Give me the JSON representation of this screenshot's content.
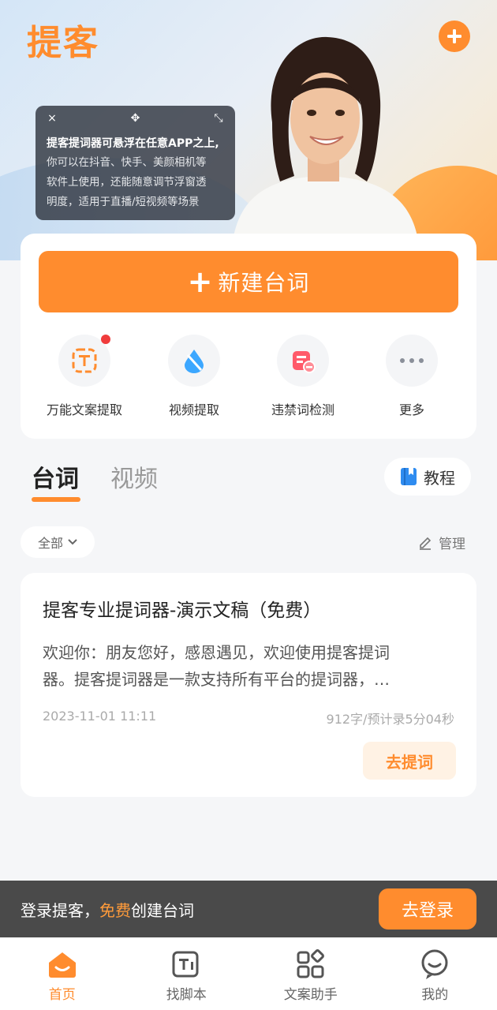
{
  "header": {
    "logo": "提客"
  },
  "popup": {
    "line1": "提客提词器可悬浮在任意APP之上,",
    "line2": "你可以在抖音、快手、美颜相机等",
    "line3": "软件上使用，还能随意调节浮窗透",
    "line4": "明度，适用于直播/短视频等场景",
    "close": "×",
    "move": "✥",
    "shrink": "⤡"
  },
  "main": {
    "new_button": "新建台词",
    "tools": [
      {
        "label": "万能文案提取",
        "badge": true
      },
      {
        "label": "视频提取"
      },
      {
        "label": "违禁词检测"
      },
      {
        "label": "更多"
      }
    ]
  },
  "tabs": [
    {
      "label": "台词",
      "active": true
    },
    {
      "label": "视频",
      "active": false
    }
  ],
  "tutorial_label": "教程",
  "filter_label": "全部",
  "manage_label": "管理",
  "script": {
    "title": "提客专业提词器-演示文稿（免费）",
    "body_line1": "欢迎你：朋友您好，感恩遇见，欢迎使用提客提词",
    "body_line2": "器。提客提词器是一款支持所有平台的提词器，…",
    "date": "2023-11-01 11:11",
    "stats": "912字/预计录5分04秒",
    "go_button": "去提词"
  },
  "login_bar": {
    "text_pre": "登录提客，",
    "text_highlight": "免费",
    "text_post": "创建台词",
    "button": "去登录"
  },
  "nav": [
    {
      "label": "首页",
      "icon": "home-icon",
      "active": true
    },
    {
      "label": "找脚本",
      "icon": "script-icon"
    },
    {
      "label": "文案助手",
      "icon": "apps-icon"
    },
    {
      "label": "我的",
      "icon": "profile-icon"
    }
  ],
  "colors": {
    "accent": "#ff8c2e",
    "badge": "#f03c3c"
  }
}
